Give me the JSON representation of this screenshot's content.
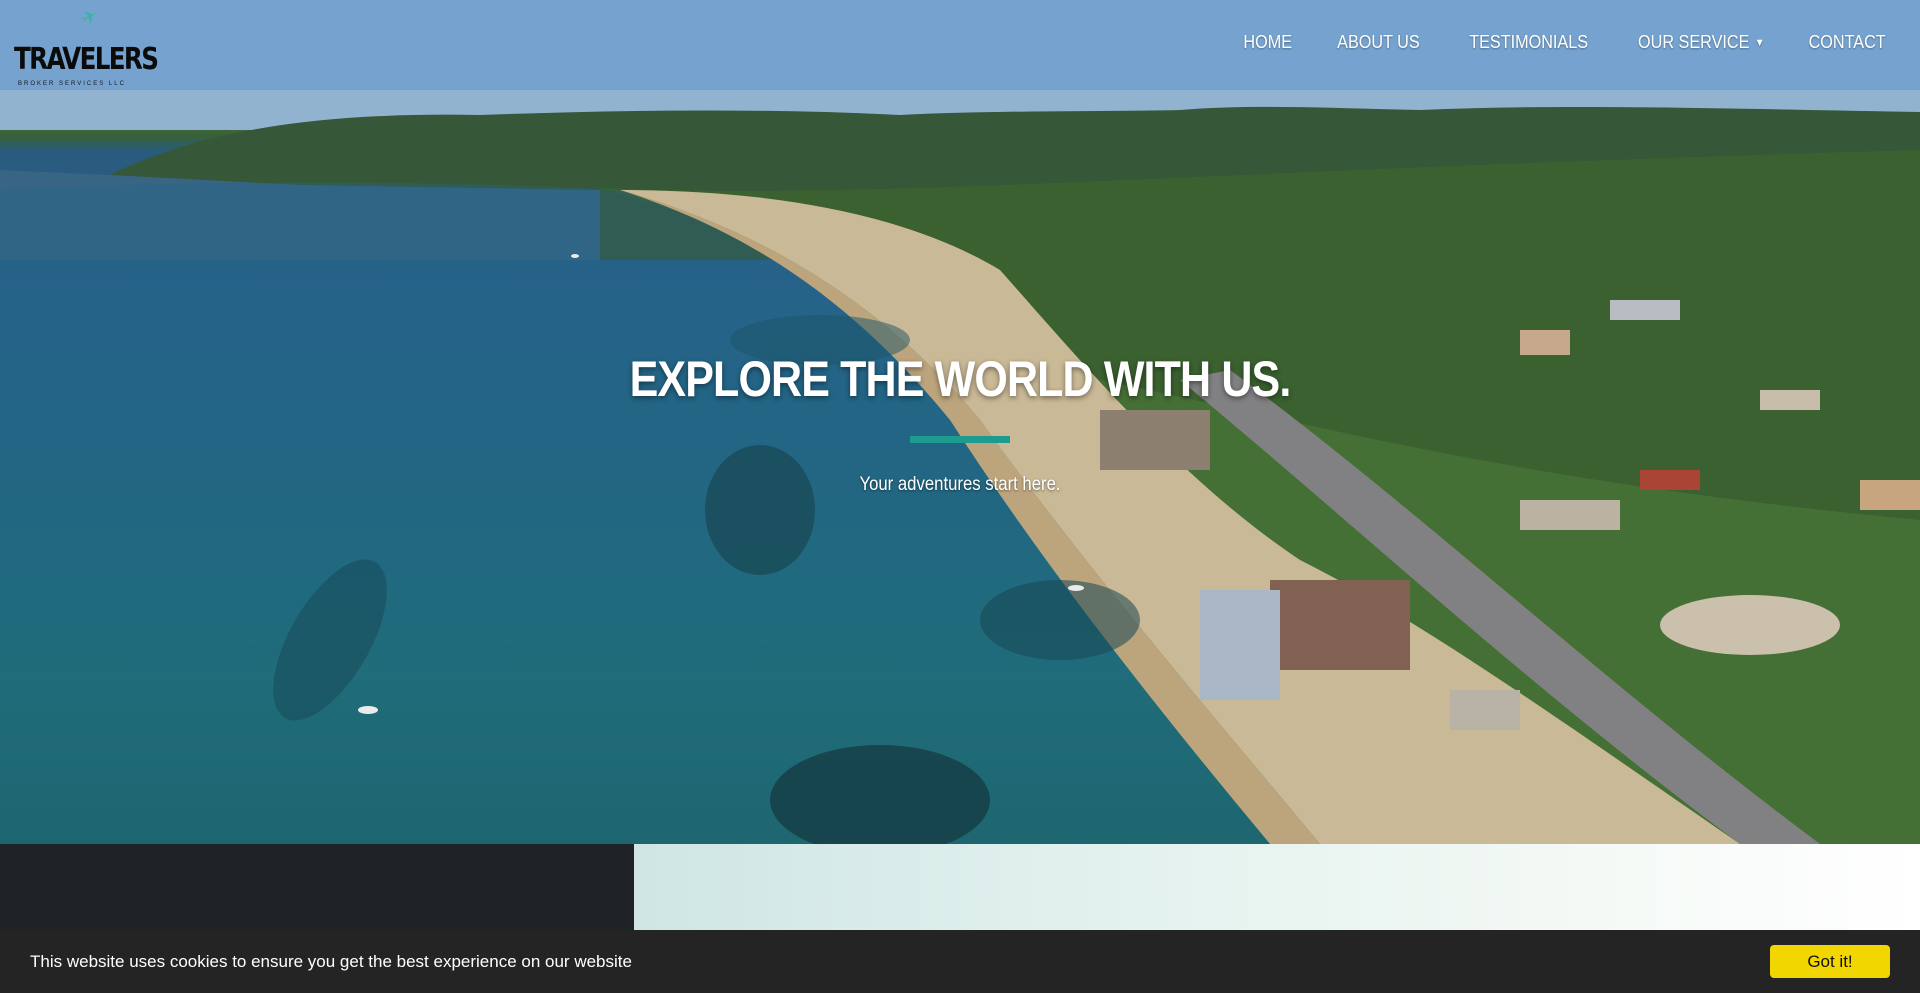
{
  "brand": {
    "name": "TRAVELERS",
    "tagline": "BROKER SERVICES LLC",
    "plane_icon": "plane-icon",
    "accent": "#1d9b8e"
  },
  "nav": {
    "items": [
      {
        "label": "HOME"
      },
      {
        "label": "ABOUT US"
      },
      {
        "label": "TESTIMONIALS"
      },
      {
        "label": "OUR SERVICE",
        "has_dropdown": true
      },
      {
        "label": "CONTACT"
      }
    ]
  },
  "hero": {
    "title": "EXPLORE THE WORLD WITH US.",
    "subtitle": "Your adventures start here."
  },
  "cookie": {
    "message": "This website uses cookies to ensure you get the best experience on our website",
    "button_label": "Got it!",
    "button_color": "#f1d600"
  }
}
